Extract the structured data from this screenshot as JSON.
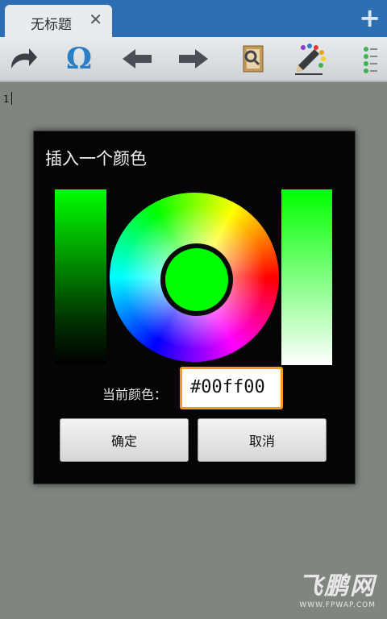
{
  "tab": {
    "title": "无标题",
    "close": "✕"
  },
  "add_tab": "+",
  "toolbar": {
    "omega": "Ω"
  },
  "editor": {
    "line_number": "1"
  },
  "dialog": {
    "title": "插入一个颜色",
    "current_color_label": "当前颜色：",
    "hex_value": "#00ff00",
    "ok_label": "确定",
    "cancel_label": "取消",
    "selected_color": "#00ff00"
  },
  "watermark": {
    "brand": "飞鹏网",
    "url": "WWW.FPWAP.COM"
  },
  "colors": {
    "tabbar": "#2d6fb2",
    "accent_border": "#f39a22",
    "toolbar_icon": "#2a7fc4"
  }
}
